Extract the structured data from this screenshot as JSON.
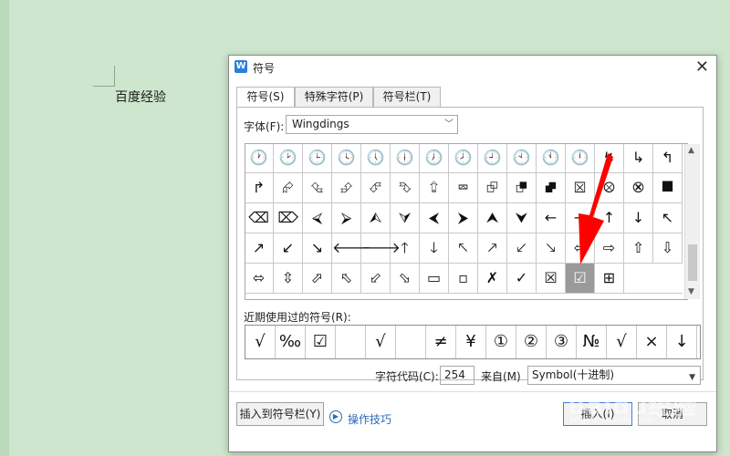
{
  "document": {
    "text": "百度经验"
  },
  "dialog": {
    "title": "符号",
    "tabs": [
      {
        "label": "符号(S)",
        "active": true
      },
      {
        "label": "特殊字符(P)",
        "active": false
      },
      {
        "label": "符号栏(T)",
        "active": false
      }
    ],
    "font_label": "字体(F):",
    "font_value": "Wingdings",
    "symbol_grid": [
      [
        "🕐",
        "🕑",
        "🕒",
        "🕓",
        "🕔",
        "🕕",
        "🕖",
        "🕗",
        "🕘",
        "🕙",
        "🕚",
        "🕛",
        "↯",
        "↳",
        "↰"
      ],
      [
        "↱",
        "⮳",
        "⮴",
        "⮵",
        "⮶",
        "⮷",
        "⮸",
        "⮹",
        "⮺",
        "⮻",
        "⮼",
        "⮽",
        "⮾",
        "⮿",
        "⯀"
      ],
      [
        "⌫",
        "⌦",
        "⮘",
        "⮚",
        "⮙",
        "⮛",
        "⮜",
        "⮞",
        "⮝",
        "⮟",
        "←",
        "→",
        "↑",
        "↓",
        "↖"
      ],
      [
        "↗",
        "↙",
        "↘",
        "🡐",
        "🡒",
        "🡑",
        "🡓",
        "🡔",
        "🡕",
        "🡗",
        "🡖",
        "⇦",
        "⇨",
        "⇧",
        "⇩"
      ],
      [
        "⬄",
        "⇳",
        "⬀",
        "⬁",
        "⬃",
        "⬂",
        "▭",
        "▫",
        "✗",
        "✓",
        "☒",
        "☑",
        "⊞"
      ]
    ],
    "selected_symbol": "☑",
    "recent_label": "近期使用过的符号(R):",
    "recent_symbols": [
      "√",
      "‰",
      "☑",
      "",
      "√",
      "",
      "≠",
      "¥",
      "①",
      "②",
      "③",
      "№",
      "√",
      "×",
      "↓"
    ],
    "code_label": "字符代码(C):",
    "code_value": "254",
    "from_label": "来自(M)",
    "from_value": "Symbol(十进制)",
    "insert_to_bar_label": "插入到符号栏(Y)",
    "tips_label": "操作技巧",
    "insert_label": "插入(I)",
    "cancel_label": "取消"
  },
  "watermark": {
    "text": "Baidu经验",
    "sub": "jingyan.baidu.com"
  },
  "colors": {
    "background": "#cde6cd",
    "accent_arrow": "#ff0000",
    "selected_cell": "#9a9a9a"
  }
}
